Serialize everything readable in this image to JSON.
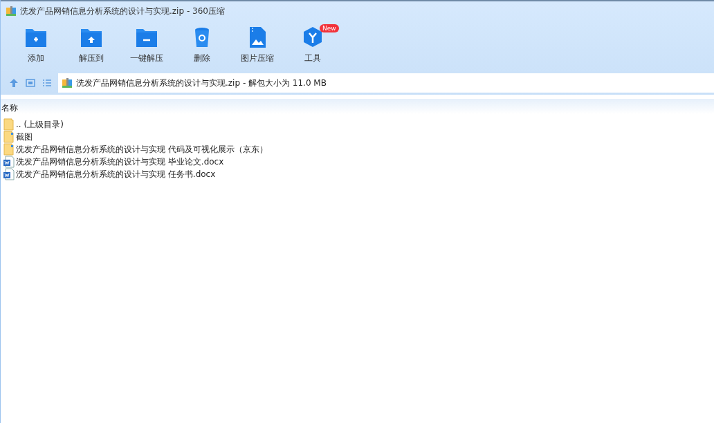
{
  "window": {
    "title": "洗发产品网销信息分析系统的设计与实现.zip - 360压缩"
  },
  "toolbar": [
    {
      "kind": "add",
      "label": "添加"
    },
    {
      "kind": "extract",
      "label": "解压到"
    },
    {
      "kind": "oneclick",
      "label": "一键解压"
    },
    {
      "kind": "delete",
      "label": "删除"
    },
    {
      "kind": "image",
      "label": "图片压缩"
    },
    {
      "kind": "tools",
      "label": "工具",
      "badge": "New"
    }
  ],
  "address": {
    "text": "洗发产品网销信息分析系统的设计与实现.zip - 解包大小为 11.0 MB"
  },
  "table": {
    "columns": [
      "名称"
    ],
    "rows": [
      {
        "kind": "folder",
        "name": ".. (上级目录)"
      },
      {
        "kind": "folder-marked",
        "name": "截图"
      },
      {
        "kind": "folder-marked",
        "name": "洗发产品网销信息分析系统的设计与实现 代码及可视化展示（京东）"
      },
      {
        "kind": "docx",
        "name": "洗发产品网销信息分析系统的设计与实现 毕业论文.docx"
      },
      {
        "kind": "docx",
        "name": "洗发产品网销信息分析系统的设计与实现 任务书.docx"
      }
    ]
  }
}
